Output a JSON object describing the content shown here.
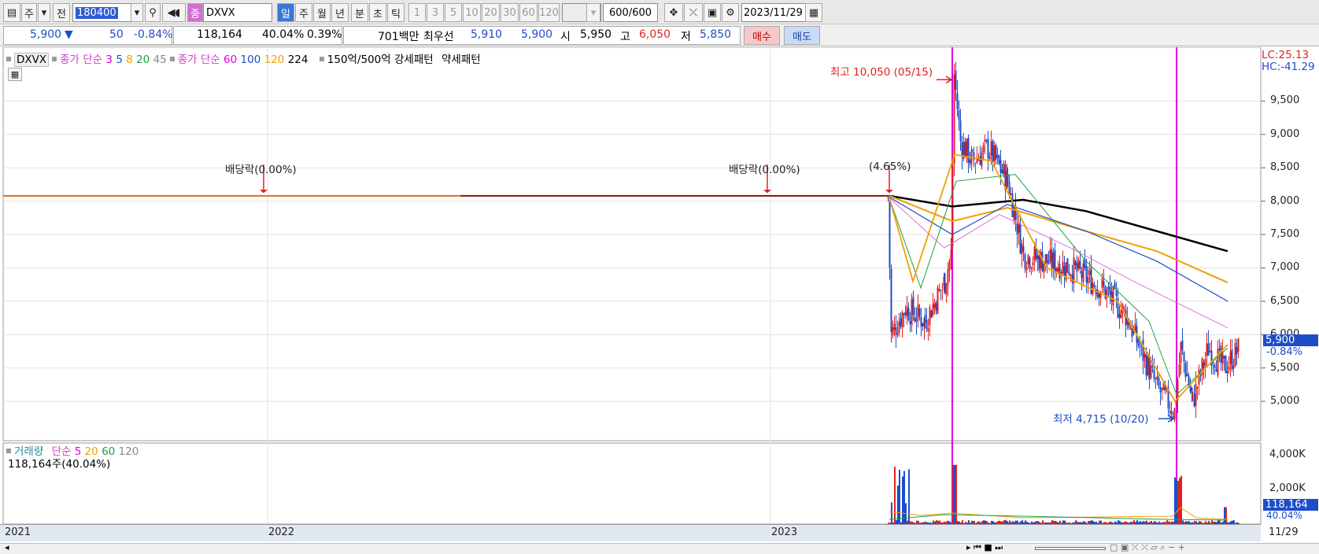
{
  "toolbar": {
    "code": "180400",
    "name": "DXVX",
    "name_prefix": "종",
    "btn_ju": "주",
    "btn_jeon": "전",
    "periods": [
      "일",
      "주",
      "월",
      "년",
      "분",
      "초",
      "틱"
    ],
    "minutes": [
      "1",
      "3",
      "5",
      "10",
      "20",
      "30",
      "60",
      "120"
    ],
    "count": "600",
    "count_total": "/600",
    "date": "2023/11/29"
  },
  "quote": {
    "price": "5,900",
    "arrow": "▼",
    "change": "50",
    "change_pct": "-0.84%",
    "volume": "118,164",
    "vol_ratio": "40.04%",
    "turnover": "0.39%",
    "amount": "701백만",
    "best_label": "최우선",
    "ask": "5,910",
    "bid": "5,900",
    "open_label": "시",
    "open": "5,950",
    "high_label": "고",
    "high": "6,050",
    "low_label": "저",
    "low": "5,850",
    "buy": "매수",
    "sell": "매도"
  },
  "legend": {
    "symbol": "DXVX",
    "ma_short_label": "종가 단순",
    "ma_short": [
      "3",
      "5",
      "8",
      "20",
      "45"
    ],
    "ma_long_label": "종가 단순",
    "ma_long": [
      "60",
      "100",
      "120",
      "224"
    ],
    "pattern_label": "150억/500억",
    "strong": "강세패턴",
    "weak": "약세패턴"
  },
  "annotations": {
    "high": "최고 10,050 (05/15)",
    "low": "최저 4,715 (10/20)",
    "div1": "배당락(0.00%)",
    "div2": "배당락(0.00%)",
    "div3": "(4.65%)",
    "lc": "LC:25.13",
    "hc": "HC:-41.29"
  },
  "price_axis": [
    "9,500",
    "9,000",
    "8,500",
    "8,000",
    "7,500",
    "7,000",
    "6,500",
    "6,000",
    "5,500",
    "5,000"
  ],
  "price_badge": {
    "price": "5,900",
    "pct": "-0.84%"
  },
  "volume_panel": {
    "label": "거래량",
    "ma_label": "단순",
    "ma": [
      "5",
      "20",
      "60",
      "120"
    ],
    "current": "118,164주(40.04%)",
    "axis": [
      "4,000K",
      "2,000K"
    ],
    "badge": "118,164",
    "badge_pct": "40.04%"
  },
  "x_axis": [
    "2021",
    "2022",
    "2023",
    "11/29"
  ],
  "colors": {
    "up": "#e02020",
    "down": "#1d4ec8",
    "magenta": "#e000e0",
    "ma224": "#000000",
    "ma120": "#f0a000",
    "ma100": "#1d4ec8"
  }
}
